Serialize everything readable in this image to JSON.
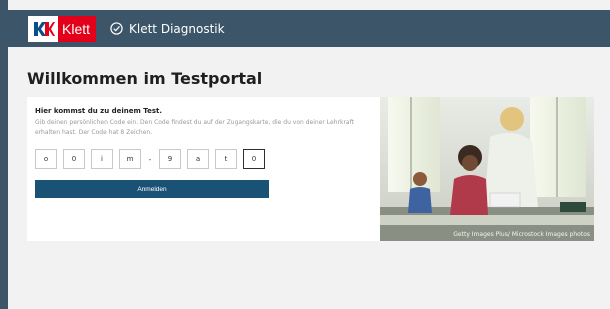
{
  "header": {
    "logo_text": "Klett",
    "app_title": "Klett Diagnostik"
  },
  "page": {
    "title": "Willkommen im Testportal"
  },
  "login": {
    "heading": "Hier kommst du zu deinem Test.",
    "description": "Gib deinen persönlichen Code ein. Den Code findest du auf der Zugangskarte, die du von deiner Lehrkraft erhalten hast. Der Code hat 8 Zeichen.",
    "code": [
      "o",
      "0",
      "i",
      "m",
      "9",
      "a",
      "t",
      "0"
    ],
    "separator": "-",
    "button_label": "Anmelden"
  },
  "photo": {
    "credit": "Getty Images Plus/ Microstock Images photos"
  },
  "colors": {
    "header_bg": "#3c5568",
    "brand_red": "#e2001a",
    "button_bg": "#1a5276"
  }
}
